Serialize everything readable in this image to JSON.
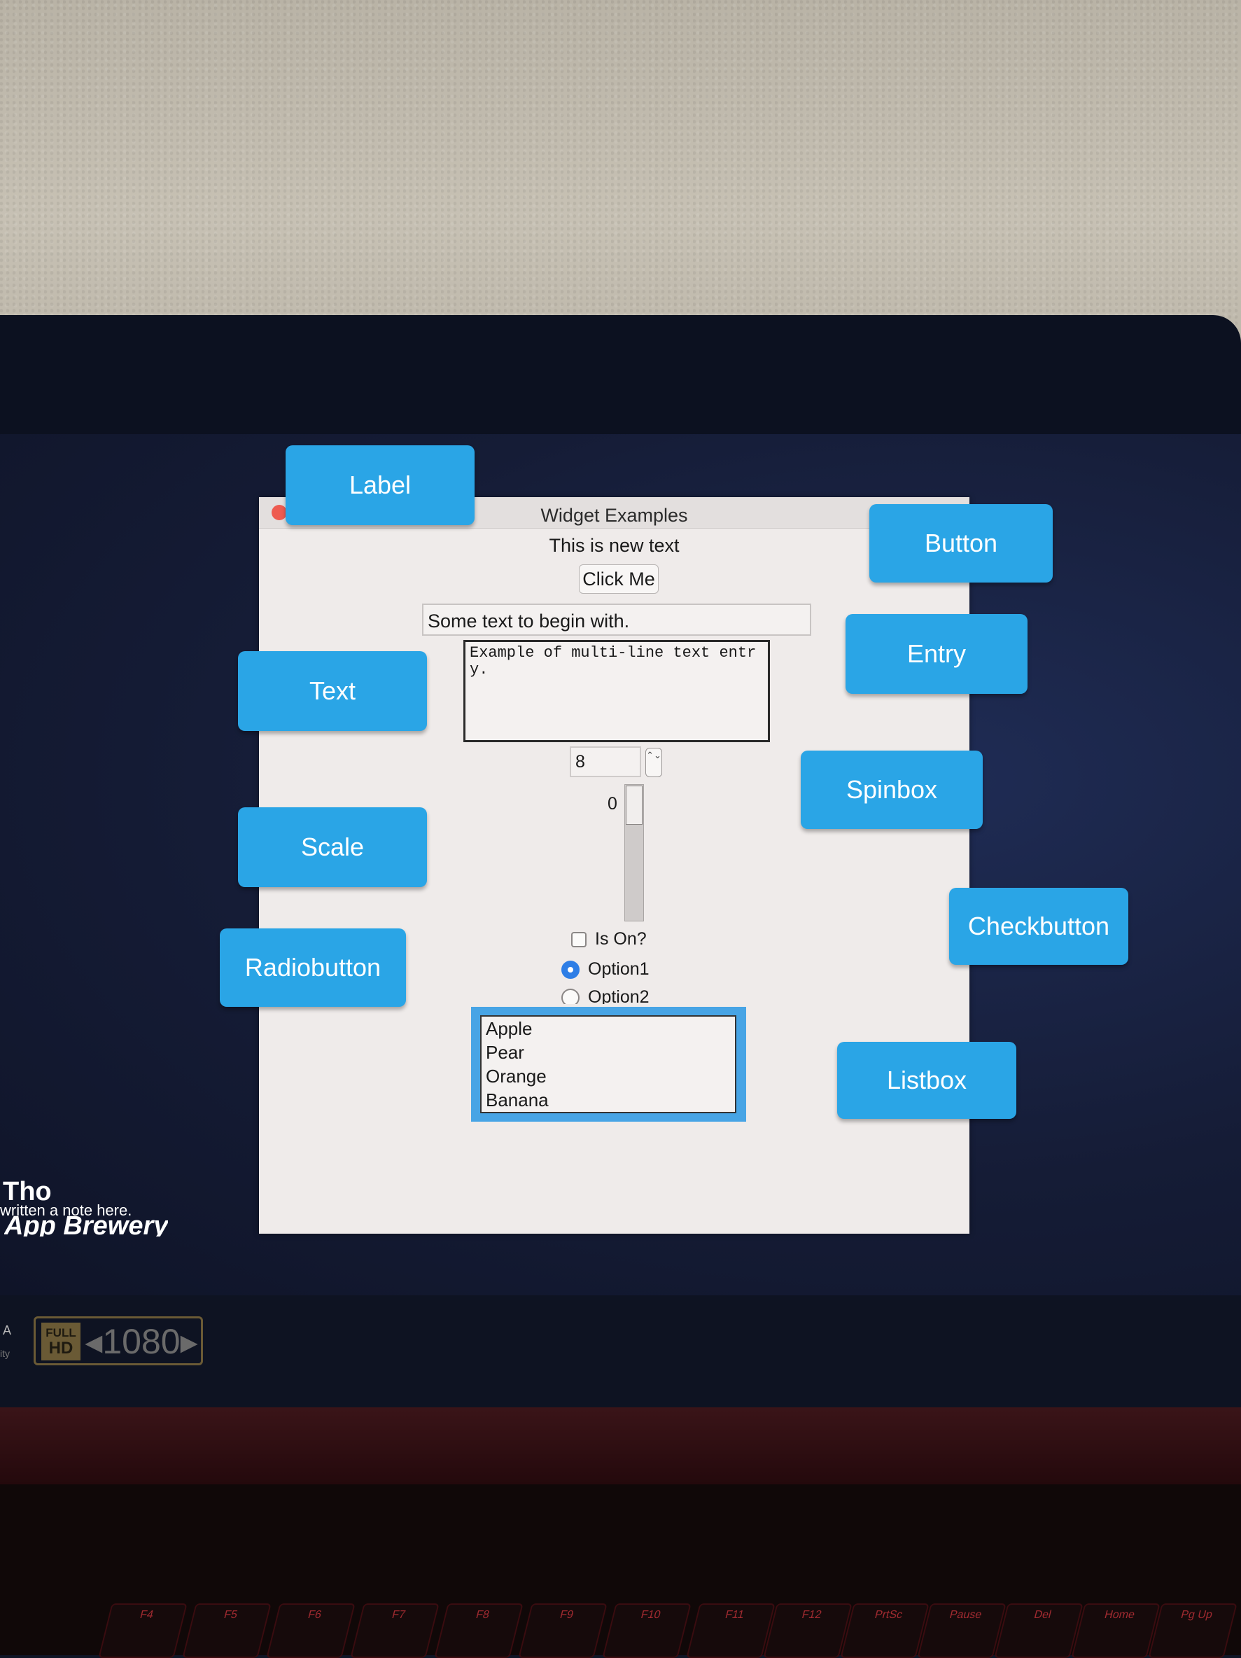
{
  "tk_window": {
    "title": "Widget Examples",
    "label_text": "This is new text",
    "button_label": "Click Me",
    "entry_value": "Some text to begin with.",
    "text_content": "Example of multi-line text entry.",
    "spinbox_value": "8",
    "spin_arrows": "⌃⌄",
    "scale_value": "0",
    "checkbutton_label": "Is On?",
    "radio_options": [
      {
        "label": "Option1",
        "selected": true
      },
      {
        "label": "Option2",
        "selected": false
      }
    ],
    "listbox_items": [
      "Apple",
      "Pear",
      "Orange",
      "Banana"
    ]
  },
  "callouts": {
    "label": "Label",
    "text": "Text",
    "scale": "Scale",
    "radiobutton": "Radiobutton",
    "button": "Button",
    "entry": "Entry",
    "spinbox": "Spinbox",
    "checkbutton": "Checkbutton",
    "listbox": "Listbox"
  },
  "overlay": {
    "title_fragment": "Tho",
    "note": "written a note here.",
    "brand": "App Brewery",
    "corner_letter": "A",
    "corner_small": "ity"
  },
  "hd_badge": {
    "full": "FULL",
    "hd": "HD",
    "resolution": "◂1080▸"
  },
  "keys": [
    "F4",
    "F5",
    "F6",
    "F7",
    "F8",
    "F9",
    "F10",
    "F11",
    "F12",
    "PrtSc",
    "Pause",
    "Del",
    "Home",
    "Pg Up"
  ],
  "colors": {
    "callout_bg": "#2aa5e6",
    "radio_selected": "#2e7ee6",
    "listbox_focus": "#47a4e5"
  }
}
